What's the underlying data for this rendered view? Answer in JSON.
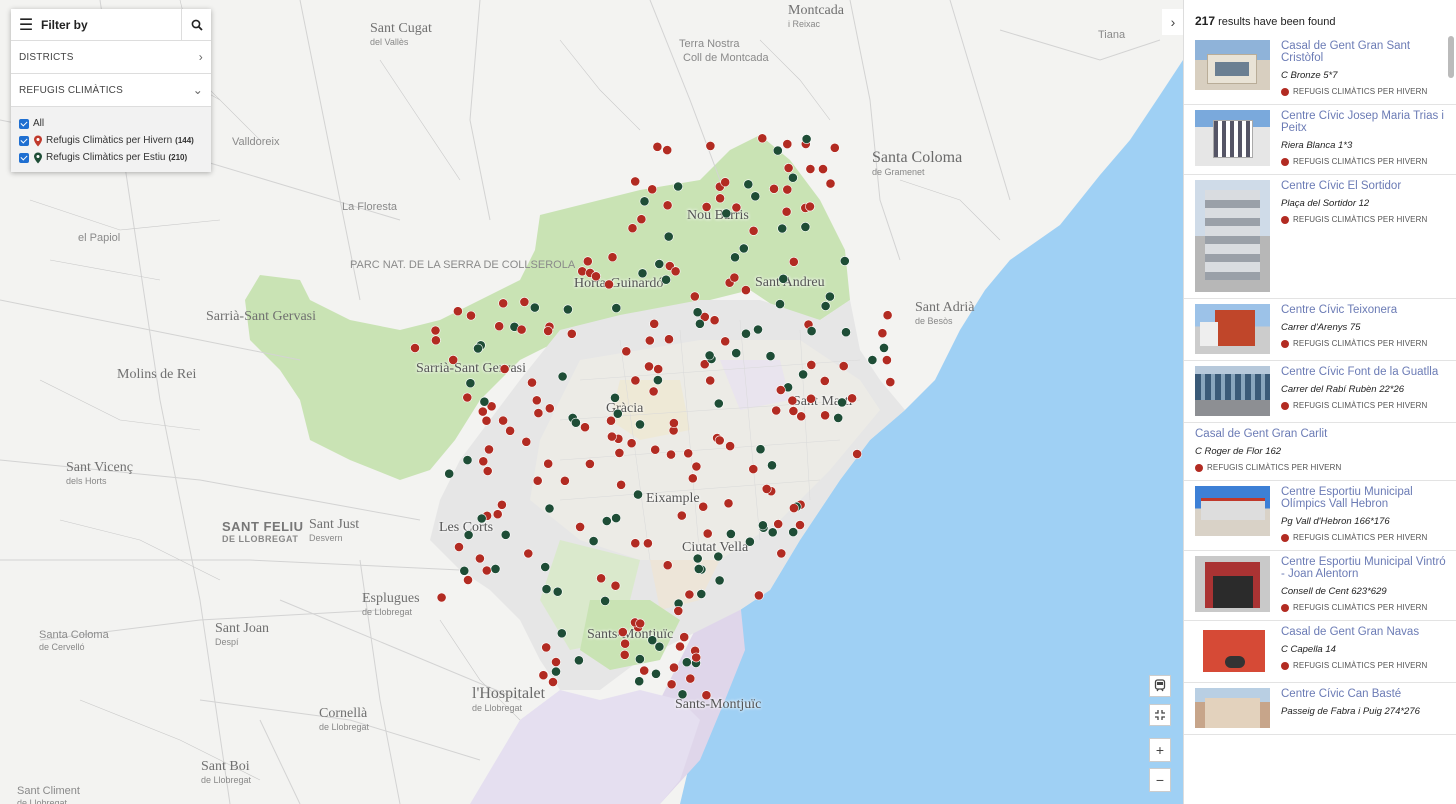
{
  "filter": {
    "title": "Filter by",
    "districts_label": "DISTRICTS",
    "refugis_label": "REFUGIS CLIMÀTICS",
    "options": [
      {
        "label": "All",
        "count": ""
      },
      {
        "label": "Refugis Climàtics per Hivern",
        "count": "(144)",
        "color": "#b22b22"
      },
      {
        "label": "Refugis Climàtics per Estiu",
        "count": "(210)",
        "color": "#1e4d36"
      }
    ]
  },
  "results": {
    "count": "217",
    "count_text": " results have been found",
    "items": [
      {
        "name": "Casal de Gent Gran Sant Cristòfol",
        "addr": "C Bronze 5*7",
        "tag": "REFUGIS CLIMÀTICS PER HIVERN",
        "thumb": "a"
      },
      {
        "name": "Centre Cívic Josep Maria Trias i Peitx",
        "addr": "Riera Blanca 1*3",
        "tag": "REFUGIS CLIMÀTICS PER HIVERN",
        "thumb": "b"
      },
      {
        "name": "Centre Cívic El Sortidor",
        "addr": "Plaça del Sortidor 12",
        "tag": "REFUGIS CLIMÀTICS PER HIVERN",
        "thumb": "c"
      },
      {
        "name": "Centre Cívic Teixonera",
        "addr": "Carrer d'Arenys 75",
        "tag": "REFUGIS CLIMÀTICS PER HIVERN",
        "thumb": "d"
      },
      {
        "name": "Centre Cívic Font de la Guatlla",
        "addr": "Carrer del Rabí Rubèn 22*26",
        "tag": "REFUGIS CLIMÀTICS PER HIVERN",
        "thumb": "e"
      },
      {
        "name": "Casal de Gent Gran Carlit",
        "addr": "C Roger de Flor 162",
        "tag": "REFUGIS CLIMÀTICS PER HIVERN",
        "thumb": ""
      },
      {
        "name": "Centre Esportiu Municipal Olímpics Vall Hebron",
        "addr": "Pg Vall d'Hebron 166*176",
        "tag": "REFUGIS CLIMÀTICS PER HIVERN",
        "thumb": "f"
      },
      {
        "name": "Centre Esportiu Municipal Vintró - Joan Alentorn",
        "addr": "Consell de Cent 623*629",
        "tag": "REFUGIS CLIMÀTICS PER HIVERN",
        "thumb": "g"
      },
      {
        "name": "Casal de Gent Gran Navas",
        "addr": "C Capella 14",
        "tag": "REFUGIS CLIMÀTICS PER HIVERN",
        "thumb": "h"
      },
      {
        "name": "Centre Cívic Can Basté",
        "addr": "Passeig de Fabra i Puig 274*276",
        "tag": "",
        "thumb": "i"
      }
    ]
  },
  "map": {
    "labels": [
      {
        "text": "Montcada",
        "sub": "i Reixac",
        "cls": "med"
      },
      {
        "text": "Sant Cugat",
        "sub": "del Vallès",
        "cls": "med"
      },
      {
        "text": "Tiana",
        "sub": "",
        "cls": "small"
      },
      {
        "text": "Santa Coloma",
        "sub": "de Gramenet",
        "cls": "big"
      },
      {
        "text": "Nou Barris",
        "sub": "",
        "cls": "city"
      },
      {
        "text": "el Papiol",
        "sub": "",
        "cls": "small"
      },
      {
        "text": "Horta-Guinardó",
        "sub": "",
        "cls": "city"
      },
      {
        "text": "Sant Andreu",
        "sub": "",
        "cls": "city"
      },
      {
        "text": "Sarrià-Sant Gervasi",
        "sub": "",
        "cls": "med"
      },
      {
        "text": "Sant Adrià",
        "sub": "de Besòs",
        "cls": "med"
      },
      {
        "text": "Sarrià-Sant Gervasi",
        "sub": "",
        "cls": "city"
      },
      {
        "text": "Molins de Rei",
        "sub": "",
        "cls": "med"
      },
      {
        "text": "Gràcia",
        "sub": "",
        "cls": "city"
      },
      {
        "text": "Sant Martí",
        "sub": "",
        "cls": "city"
      },
      {
        "text": "Sant Vicenç",
        "sub": "dels Horts",
        "cls": "med"
      },
      {
        "text": "Eixample",
        "sub": "",
        "cls": "city"
      },
      {
        "text": "SANT FELIU",
        "sub": "DE LLOBREGAT",
        "cls": "bold"
      },
      {
        "text": "Sant Just",
        "sub": "Desvern",
        "cls": "med"
      },
      {
        "text": "Les Corts",
        "sub": "",
        "cls": "city"
      },
      {
        "text": "Ciutat Vella",
        "sub": "",
        "cls": "city"
      },
      {
        "text": "Esplugues",
        "sub": "de Llobregat",
        "cls": "med"
      },
      {
        "text": "Sant Joan",
        "sub": "Despí",
        "cls": "med"
      },
      {
        "text": "Santa Coloma",
        "sub": "de Cervelló",
        "cls": "small"
      },
      {
        "text": "Sants-Montjuïc",
        "sub": "",
        "cls": "city"
      },
      {
        "text": "l'Hospitalet",
        "sub": "de Llobregat",
        "cls": "big"
      },
      {
        "text": "Sants-Montjuïc",
        "sub": "",
        "cls": "city"
      },
      {
        "text": "Cornellà",
        "sub": "de Llobregat",
        "cls": "med"
      },
      {
        "text": "Sant Boi",
        "sub": "de Llobregat",
        "cls": "med"
      },
      {
        "text": "Sant Climent",
        "sub": "de Llobregat",
        "cls": "small"
      },
      {
        "text": "PARC NAT. DE LA SERRA DE COLLSEROLA",
        "sub": "",
        "cls": "small"
      },
      {
        "text": "Valldoreix",
        "sub": "",
        "cls": "small"
      },
      {
        "text": "La Floresta",
        "sub": "",
        "cls": "small"
      },
      {
        "text": "Terra Nostra",
        "sub": "",
        "cls": "small"
      },
      {
        "text": "Coll de Montcada",
        "sub": "",
        "cls": "small"
      }
    ],
    "winter_color": "#b22b22",
    "summer_color": "#1e4d36"
  }
}
